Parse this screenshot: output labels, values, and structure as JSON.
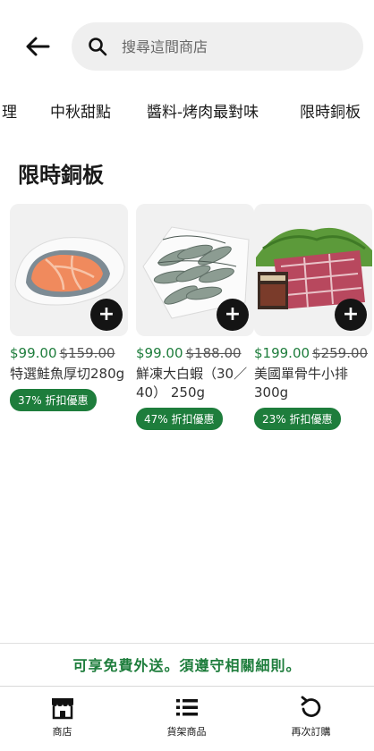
{
  "search": {
    "placeholder": "搜尋這間商店"
  },
  "tabs": [
    {
      "label": "理"
    },
    {
      "label": "中秋甜點"
    },
    {
      "label": "醬料-烤肉最對味"
    },
    {
      "label": "限時銅板"
    }
  ],
  "active_tab": "限時銅板",
  "section": {
    "title": "限時銅板"
  },
  "products": [
    {
      "price": "$99.00",
      "old_price": "$159.00",
      "name": "特選鮭魚厚切280g",
      "discount": "37% 折扣優惠",
      "image": "salmon-steak"
    },
    {
      "price": "$99.00",
      "old_price": "$188.00",
      "name": "鮮凍大白蝦（30／40） 250g",
      "discount": "47% 折扣優惠",
      "image": "white-shrimp"
    },
    {
      "price": "$199.00",
      "old_price": "$259.00",
      "name": "美國單骨牛小排300g",
      "discount": "23% 折扣優惠",
      "image": "beef-short-ribs"
    }
  ],
  "footer": {
    "notice": "可享免費外送。須遵守相關細則。"
  },
  "nav": [
    {
      "label": "商店",
      "icon": "store-icon"
    },
    {
      "label": "貨架商品",
      "icon": "list-icon"
    },
    {
      "label": "再次訂購",
      "icon": "reorder-icon"
    }
  ],
  "colors": {
    "accent": "#1e7d3c",
    "text": "#1a1a1a",
    "badge_text": "#ffffff"
  }
}
